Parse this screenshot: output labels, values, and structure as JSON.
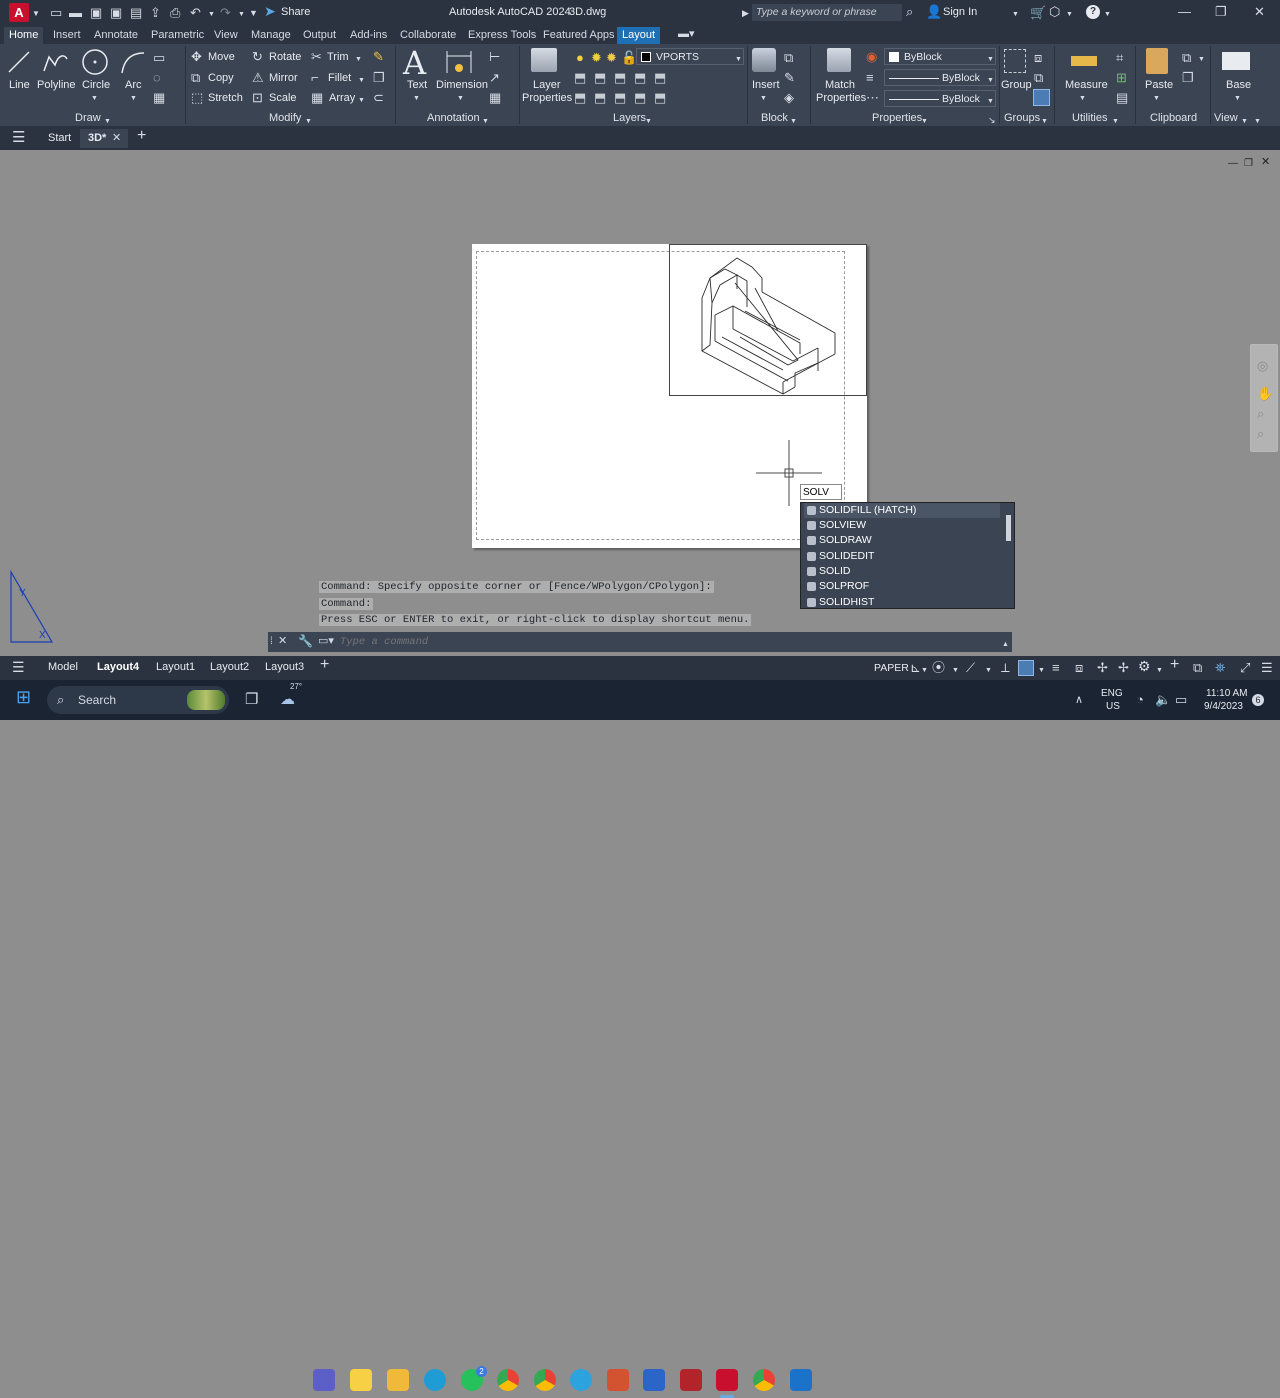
{
  "app": {
    "title": "Autodesk AutoCAD 2024",
    "file": "3D.dwg",
    "share": "Share",
    "search_placeholder": "Type a keyword or phrase",
    "sign_in": "Sign In"
  },
  "ribbon_tabs": [
    "Home",
    "Insert",
    "Annotate",
    "Parametric",
    "View",
    "Manage",
    "Output",
    "Add-ins",
    "Collaborate",
    "Express Tools",
    "Featured Apps",
    "Layout"
  ],
  "draw": {
    "line": "Line",
    "polyline": "Polyline",
    "circle": "Circle",
    "arc": "Arc",
    "group": "Draw"
  },
  "modify": {
    "move": "Move",
    "rotate": "Rotate",
    "trim": "Trim",
    "copy": "Copy",
    "mirror": "Mirror",
    "fillet": "Fillet",
    "stretch": "Stretch",
    "scale": "Scale",
    "array": "Array",
    "group": "Modify"
  },
  "annotation": {
    "text": "Text",
    "dimension": "Dimension",
    "group": "Annotation"
  },
  "layers": {
    "layer_properties_1": "Layer",
    "layer_properties_2": "Properties",
    "current_layer": "VPORTS",
    "group": "Layers"
  },
  "block": {
    "insert": "Insert",
    "group": "Block"
  },
  "properties": {
    "match_1": "Match",
    "match_2": "Properties",
    "color": "ByBlock",
    "linetype": "ByBlock",
    "lineweight": "ByBlock",
    "group": "Properties"
  },
  "groups": {
    "group": "Group",
    "group_label": "Groups"
  },
  "utilities": {
    "measure": "Measure",
    "group": "Utilities"
  },
  "clipboard": {
    "paste": "Paste",
    "group": "Clipboard"
  },
  "view": {
    "base": "Base",
    "group": "View"
  },
  "file_tabs": {
    "start": "Start",
    "current": "3D*"
  },
  "command_line": {
    "history": [
      "Command: Specify opposite corner or [Fence/WPolygon/CPolygon]:",
      "Command:",
      "Press ESC or ENTER to exit, or right-click to display shortcut menu."
    ],
    "placeholder": "Type a command",
    "cursor_input": "SOLV"
  },
  "autocomplete": [
    "SOLIDFILL (HATCH)",
    "SOLVIEW",
    "SOLDRAW",
    "SOLIDEDIT",
    "SOLID",
    "SOLPROF",
    "SOLIDHIST"
  ],
  "layout_tabs": [
    "Model",
    "Layout4",
    "Layout1",
    "Layout2",
    "Layout3"
  ],
  "active_layout": "Layout4",
  "status": {
    "paper": "PAPER"
  },
  "taskbar": {
    "search": "Search",
    "weather": "27°",
    "lang_1": "ENG",
    "lang_2": "US",
    "time": "11:10 AM",
    "date": "9/4/2023",
    "notif": "6",
    "whatsapp_badge": "2"
  },
  "colors": {
    "ribbon_bg": "#3b4453",
    "title_bg": "#2b3340",
    "accent": "#1e6fb3",
    "canvas": "#8e8e8e"
  }
}
